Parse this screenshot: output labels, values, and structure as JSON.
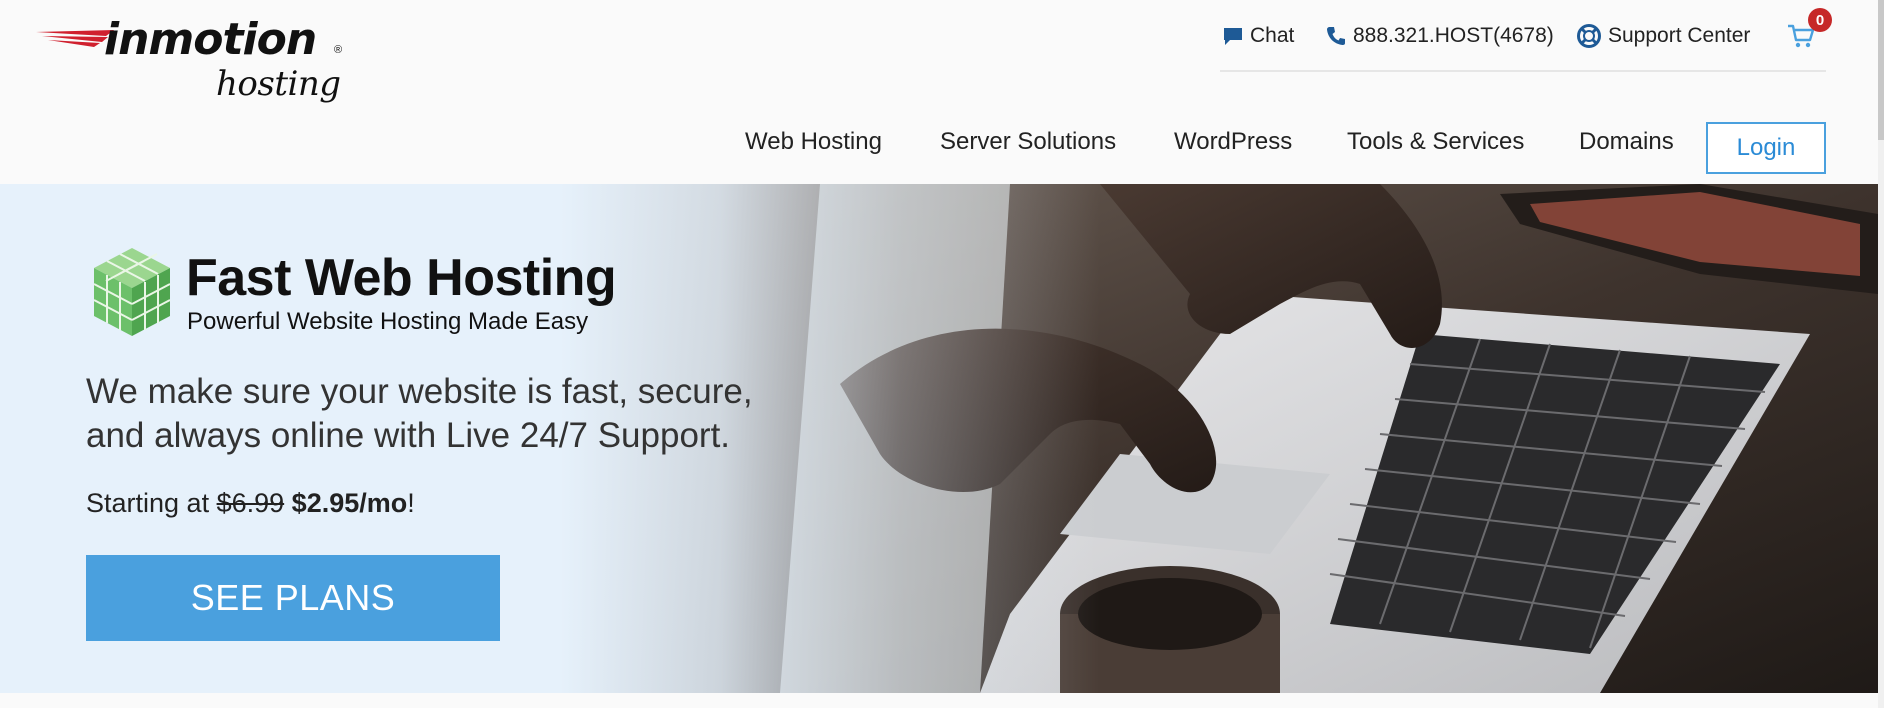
{
  "brand": {
    "name": "inmotion",
    "reg": "®",
    "sub": "hosting"
  },
  "utility": {
    "chat": "Chat",
    "phone": "888.321.HOST(4678)",
    "support": "Support Center",
    "cart_count": "0"
  },
  "nav": {
    "items": [
      "Web Hosting",
      "Server Solutions",
      "WordPress",
      "Tools & Services",
      "Domains"
    ],
    "login": "Login"
  },
  "hero": {
    "title": "Fast Web Hosting",
    "subtitle": "Powerful Website Hosting Made Easy",
    "body_line1": "We make sure your website is fast, secure,",
    "body_line2": "and always online with Live 24/7 Support.",
    "price_prefix": "Starting at ",
    "price_old": "$6.99",
    "price_new": "$2.95/mo",
    "price_suffix": "!",
    "cta": "SEE PLANS"
  },
  "colors": {
    "accent": "#4aa0de",
    "badge": "#c62828",
    "logo_red": "#d0202e",
    "cube_green": "#6cc06a"
  },
  "icons": [
    "chat-icon",
    "phone-icon",
    "lifebuoy-icon",
    "cart-icon",
    "cube-icon"
  ]
}
